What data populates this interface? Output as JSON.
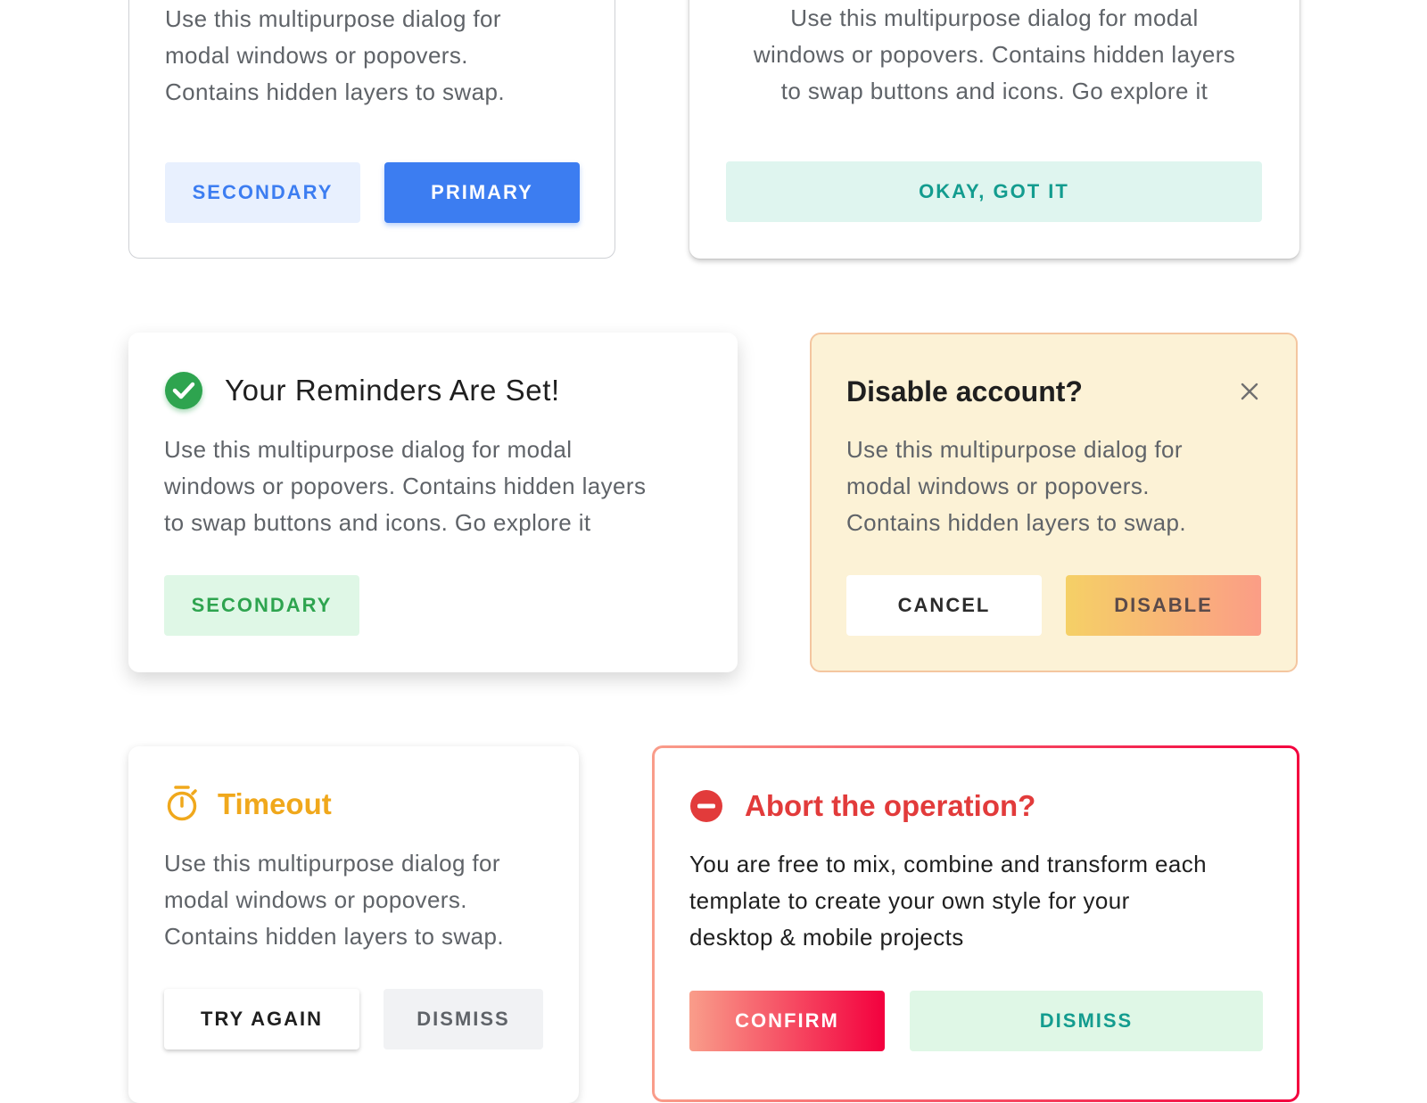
{
  "colors": {
    "primary_blue": "#3c7df1",
    "secondary_blue_bg": "#e8f0fe",
    "teal_bg": "#dff5ef",
    "teal_text": "#139c8f",
    "green_bg": "#dff7e6",
    "green_text": "#2ea44f",
    "warning_bg": "#fcf2d6",
    "warning_border": "#f4c6a0",
    "timeout_orange": "#f0a81c",
    "danger_red": "#e23b3b",
    "confirm_gradient_start": "#f99d8a",
    "confirm_gradient_end": "#f3003e",
    "disable_gradient_start": "#f5d066",
    "disable_gradient_end": "#fb9d86"
  },
  "card1": {
    "body_lines": [
      "Use this multipurpose dialog for",
      "modal windows or popovers.",
      "Contains hidden layers to swap."
    ],
    "secondary_label": "SECONDARY",
    "primary_label": "PRIMARY"
  },
  "card2": {
    "body_lines": [
      "Use this multipurpose dialog for modal",
      "windows or popovers. Contains hidden layers",
      "to swap buttons and icons. Go explore it"
    ],
    "ok_label": "OKAY, GOT IT"
  },
  "card3": {
    "icon": "check-circle-icon",
    "title": "Your Reminders Are Set!",
    "body_lines": [
      "Use this multipurpose dialog for modal",
      "windows or popovers. Contains hidden layers",
      "to swap buttons and icons. Go explore it"
    ],
    "secondary_label": "SECONDARY"
  },
  "card4": {
    "title": "Disable account?",
    "close_icon": "close-icon",
    "body_lines": [
      "Use this multipurpose dialog for",
      "modal windows or popovers.",
      "Contains hidden layers to swap."
    ],
    "cancel_label": "CANCEL",
    "disable_label": "DISABLE"
  },
  "card5": {
    "icon": "stopwatch-icon",
    "title": "Timeout",
    "body_lines": [
      "Use this multipurpose dialog for",
      "modal windows or popovers.",
      "Contains hidden layers to swap."
    ],
    "try_again_label": "TRY AGAIN",
    "dismiss_label": "DISMISS"
  },
  "card6": {
    "icon": "minus-circle-icon",
    "title": "Abort the operation?",
    "body_lines": [
      "You are free to mix, combine and transform each",
      "template to create your own style for your",
      "desktop & mobile projects"
    ],
    "confirm_label": "CONFIRM",
    "dismiss_label": "DISMISS"
  }
}
